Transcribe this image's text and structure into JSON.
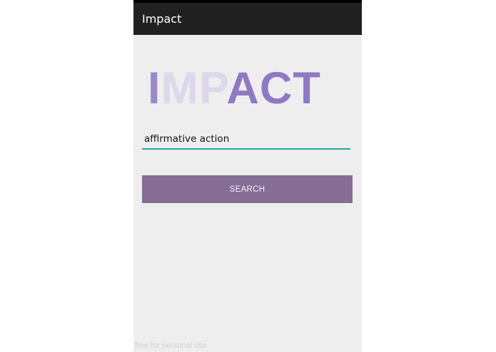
{
  "app": {
    "title": "Impact"
  },
  "logo": {
    "part1": "I",
    "part2": "MP",
    "part3": "ACT"
  },
  "search": {
    "value": "affirmative action",
    "button_label": "SEARCH"
  },
  "watermark": {
    "text": "free for personal use"
  },
  "colors": {
    "action_bar": "#212121",
    "background": "#eeeeee",
    "button": "#866d96",
    "input_underline": "#2aa198"
  }
}
